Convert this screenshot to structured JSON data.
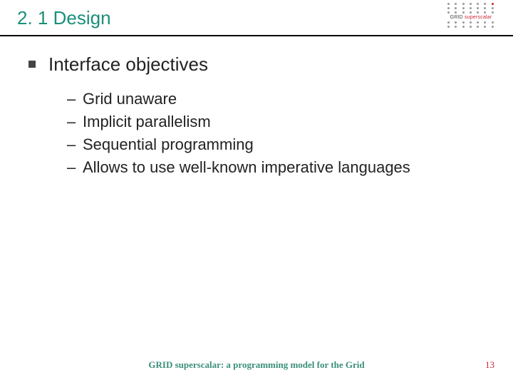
{
  "header": {
    "title": "2. 1 Design",
    "logo": {
      "line1": "GRID ",
      "line1_accent": "superscalar"
    }
  },
  "body": {
    "heading": "Interface objectives",
    "items": [
      "Grid unaware",
      "Implicit parallelism",
      "Sequential programming",
      "Allows to use well-known imperative languages"
    ]
  },
  "footer": {
    "text": "GRID superscalar: a programming model for the Grid",
    "page": "13"
  }
}
